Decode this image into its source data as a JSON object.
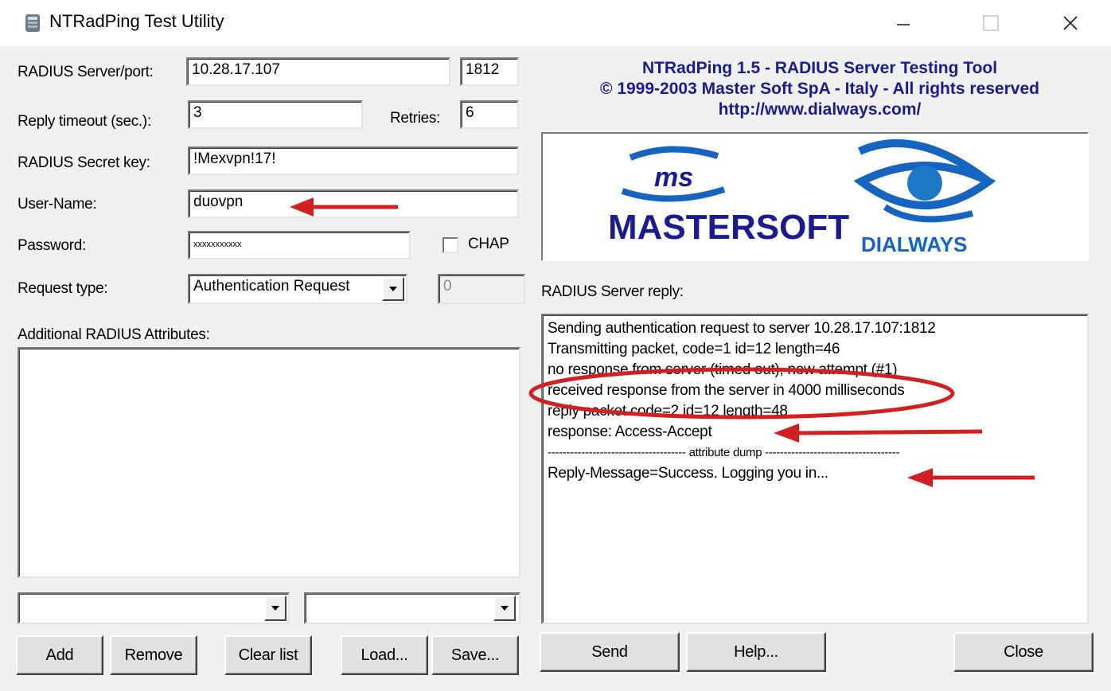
{
  "window": {
    "title": "NTRadPing Test Utility"
  },
  "form": {
    "server_label": "RADIUS Server/port:",
    "server_value": "10.28.17.107",
    "port_value": "1812",
    "timeout_label": "Reply timeout (sec.):",
    "timeout_value": "3",
    "retries_label": "Retries:",
    "retries_value": "6",
    "secret_label": "RADIUS Secret key:",
    "secret_value": "!Mexvpn!17!",
    "username_label": "User-Name:",
    "username_value": "duovpn",
    "password_label": "Password:",
    "password_value": "xxxxxxxxxxx",
    "chap_label": "CHAP",
    "chap_checked": false,
    "request_type_label": "Request type:",
    "request_type_value": "Authentication Request",
    "request_extra_value": "0",
    "attrs_label": "Additional RADIUS Attributes:"
  },
  "buttons": {
    "add": "Add",
    "remove": "Remove",
    "clear_list": "Clear list",
    "load": "Load...",
    "save": "Save...",
    "send": "Send",
    "help": "Help...",
    "close": "Close"
  },
  "header": {
    "line1": "NTRadPing 1.5 - RADIUS Server Testing Tool",
    "line2": "© 1999-2003 Master Soft SpA - Italy - All rights reserved",
    "line3": "http://www.dialways.com/"
  },
  "logos": {
    "ms_text": "ms",
    "mastersoft_text": "MASTERSOFT",
    "dialways_text": "DIALWAYS",
    "ms_color": "#1b1b8f",
    "accent_color": "#1565c0"
  },
  "reply": {
    "label": "RADIUS Server reply:",
    "lines": [
      "Sending authentication request to server 10.28.17.107:1812",
      "Transmitting packet, code=1 id=12 length=46",
      "no response from server (timed out), new attempt (#1)",
      "received response from the server in 4000 milliseconds",
      "reply packet code=2 id=12 length=48",
      "response: Access-Accept",
      "------------------------------------- attribute dump ------------------------------------",
      "Reply-Message=Success. Logging you in..."
    ]
  },
  "annotations": {
    "color": "#d21f1f"
  }
}
